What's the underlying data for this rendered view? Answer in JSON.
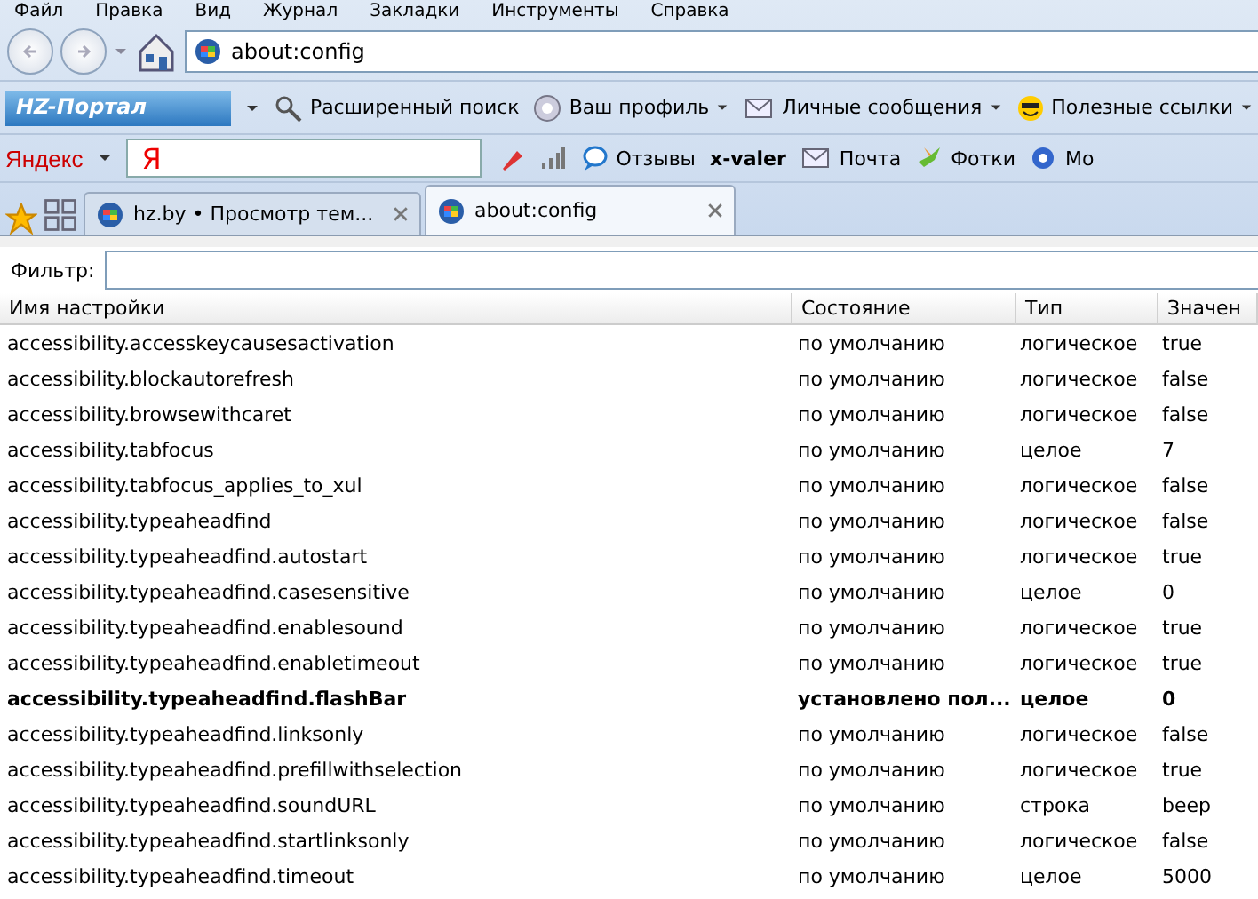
{
  "menu": [
    "Файл",
    "Правка",
    "Вид",
    "Журнал",
    "Закладки",
    "Инструменты",
    "Справка"
  ],
  "address": {
    "value": "about:config"
  },
  "toolbar1": {
    "logo": "HZ-Портал",
    "items": [
      {
        "label": "Расширенный поиск",
        "kind": "search",
        "menu": false
      },
      {
        "label": "Ваш профиль",
        "kind": "profile",
        "menu": true
      },
      {
        "label": "Личные сообщения",
        "kind": "mail",
        "menu": true
      },
      {
        "label": "Полезные ссылки",
        "kind": "smile",
        "menu": true
      }
    ]
  },
  "toolbar2": {
    "brand": "Яндекс",
    "search_logo": "Я",
    "items": [
      {
        "label": "Отзывы",
        "kind": "bubble"
      },
      {
        "label": "x-valer",
        "kind": "user"
      },
      {
        "label": "Почта",
        "kind": "mail"
      },
      {
        "label": "Фотки",
        "kind": "bird"
      },
      {
        "label": "Мо",
        "kind": "flower"
      }
    ]
  },
  "tabs": [
    {
      "label": "hz.by • Просмотр тем...",
      "selected": false
    },
    {
      "label": "about:config",
      "selected": true
    }
  ],
  "filter": {
    "label": "Фильтр:"
  },
  "table": {
    "columns": [
      "Имя настройки",
      "Состояние",
      "Тип",
      "Значен"
    ],
    "rows": [
      {
        "name": "accessibility.accesskeycausesactivation",
        "status": "по умолчанию",
        "type": "логическое",
        "value": "true",
        "modified": false
      },
      {
        "name": "accessibility.blockautorefresh",
        "status": "по умолчанию",
        "type": "логическое",
        "value": "false",
        "modified": false
      },
      {
        "name": "accessibility.browsewithcaret",
        "status": "по умолчанию",
        "type": "логическое",
        "value": "false",
        "modified": false
      },
      {
        "name": "accessibility.tabfocus",
        "status": "по умолчанию",
        "type": "целое",
        "value": "7",
        "modified": false
      },
      {
        "name": "accessibility.tabfocus_applies_to_xul",
        "status": "по умолчанию",
        "type": "логическое",
        "value": "false",
        "modified": false
      },
      {
        "name": "accessibility.typeaheadfind",
        "status": "по умолчанию",
        "type": "логическое",
        "value": "false",
        "modified": false
      },
      {
        "name": "accessibility.typeaheadfind.autostart",
        "status": "по умолчанию",
        "type": "логическое",
        "value": "true",
        "modified": false
      },
      {
        "name": "accessibility.typeaheadfind.casesensitive",
        "status": "по умолчанию",
        "type": "целое",
        "value": "0",
        "modified": false
      },
      {
        "name": "accessibility.typeaheadfind.enablesound",
        "status": "по умолчанию",
        "type": "логическое",
        "value": "true",
        "modified": false
      },
      {
        "name": "accessibility.typeaheadfind.enabletimeout",
        "status": "по умолчанию",
        "type": "логическое",
        "value": "true",
        "modified": false
      },
      {
        "name": "accessibility.typeaheadfind.flashBar",
        "status": "установлено пол...",
        "type": "целое",
        "value": "0",
        "modified": true
      },
      {
        "name": "accessibility.typeaheadfind.linksonly",
        "status": "по умолчанию",
        "type": "логическое",
        "value": "false",
        "modified": false
      },
      {
        "name": "accessibility.typeaheadfind.prefillwithselection",
        "status": "по умолчанию",
        "type": "логическое",
        "value": "true",
        "modified": false
      },
      {
        "name": "accessibility.typeaheadfind.soundURL",
        "status": "по умолчанию",
        "type": "строка",
        "value": "beep",
        "modified": false
      },
      {
        "name": "accessibility.typeaheadfind.startlinksonly",
        "status": "по умолчанию",
        "type": "логическое",
        "value": "false",
        "modified": false
      },
      {
        "name": "accessibility.typeaheadfind.timeout",
        "status": "по умолчанию",
        "type": "целое",
        "value": "5000",
        "modified": false
      }
    ]
  }
}
